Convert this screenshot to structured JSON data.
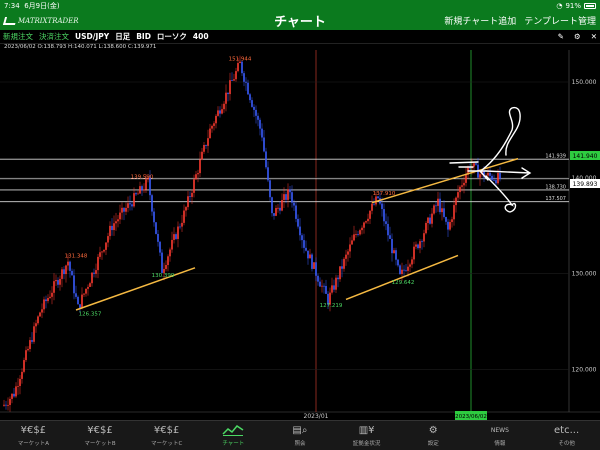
{
  "status_bar": {
    "time": "7:34",
    "date": "6月9日(金)",
    "battery": "91%"
  },
  "header": {
    "logo": "MATRIXTRADER",
    "title": "チャート",
    "actions": [
      "新規チャート追加",
      "テンプレート管理"
    ]
  },
  "toolbar": {
    "new_order": "新規注文",
    "settle_order": "決済注文",
    "symbol": "USD/JPY",
    "timeframe": "日足",
    "price_type": "BID",
    "chart_type": "ローソク",
    "bars": "400"
  },
  "ohlc_line": "2023/06/02  O:138.793  H:140.071  L:138.600  C:139.971",
  "chart": {
    "price_ticks": [
      "150.000",
      "140.000",
      "130.000",
      "120.000"
    ],
    "level_labels": [
      "141.939",
      "138.730",
      "137.507"
    ],
    "current_price": "139.893",
    "crosshair_price": "141.940",
    "x_labels": {
      "year": "2023/01",
      "cursor_date": "2023/06/02"
    },
    "annotations": [
      {
        "text": "151.944",
        "kind": "high"
      },
      {
        "text": "139.590",
        "kind": "high"
      },
      {
        "text": "131.348",
        "kind": "high"
      },
      {
        "text": "137.910",
        "kind": "high"
      },
      {
        "text": "126.357",
        "kind": "low"
      },
      {
        "text": "130.399",
        "kind": "low"
      },
      {
        "text": "127.219",
        "kind": "low"
      },
      {
        "text": "129.642",
        "kind": "low"
      }
    ],
    "colors": {
      "up": "#ff3b30",
      "down": "#3a5cff",
      "trendline": "#f5b942",
      "level": "#d8d8d8",
      "price_box": "#2ecc40"
    }
  },
  "tabs": [
    {
      "label": "マーケットA",
      "icon": "¥€$£",
      "active": false
    },
    {
      "label": "マーケットB",
      "icon": "¥€$£",
      "active": false
    },
    {
      "label": "マーケットC",
      "icon": "¥€$£",
      "active": false
    },
    {
      "label": "チャート",
      "icon": "chart-icon",
      "active": true
    },
    {
      "label": "照会",
      "icon": "search-icon",
      "active": false
    },
    {
      "label": "証拠金状況",
      "icon": "margin-icon",
      "active": false
    },
    {
      "label": "設定",
      "icon": "gear-icon",
      "active": false
    },
    {
      "label": "情報",
      "icon": "NEWS",
      "active": false
    },
    {
      "label": "その他",
      "icon": "etc...",
      "active": false
    }
  ]
}
